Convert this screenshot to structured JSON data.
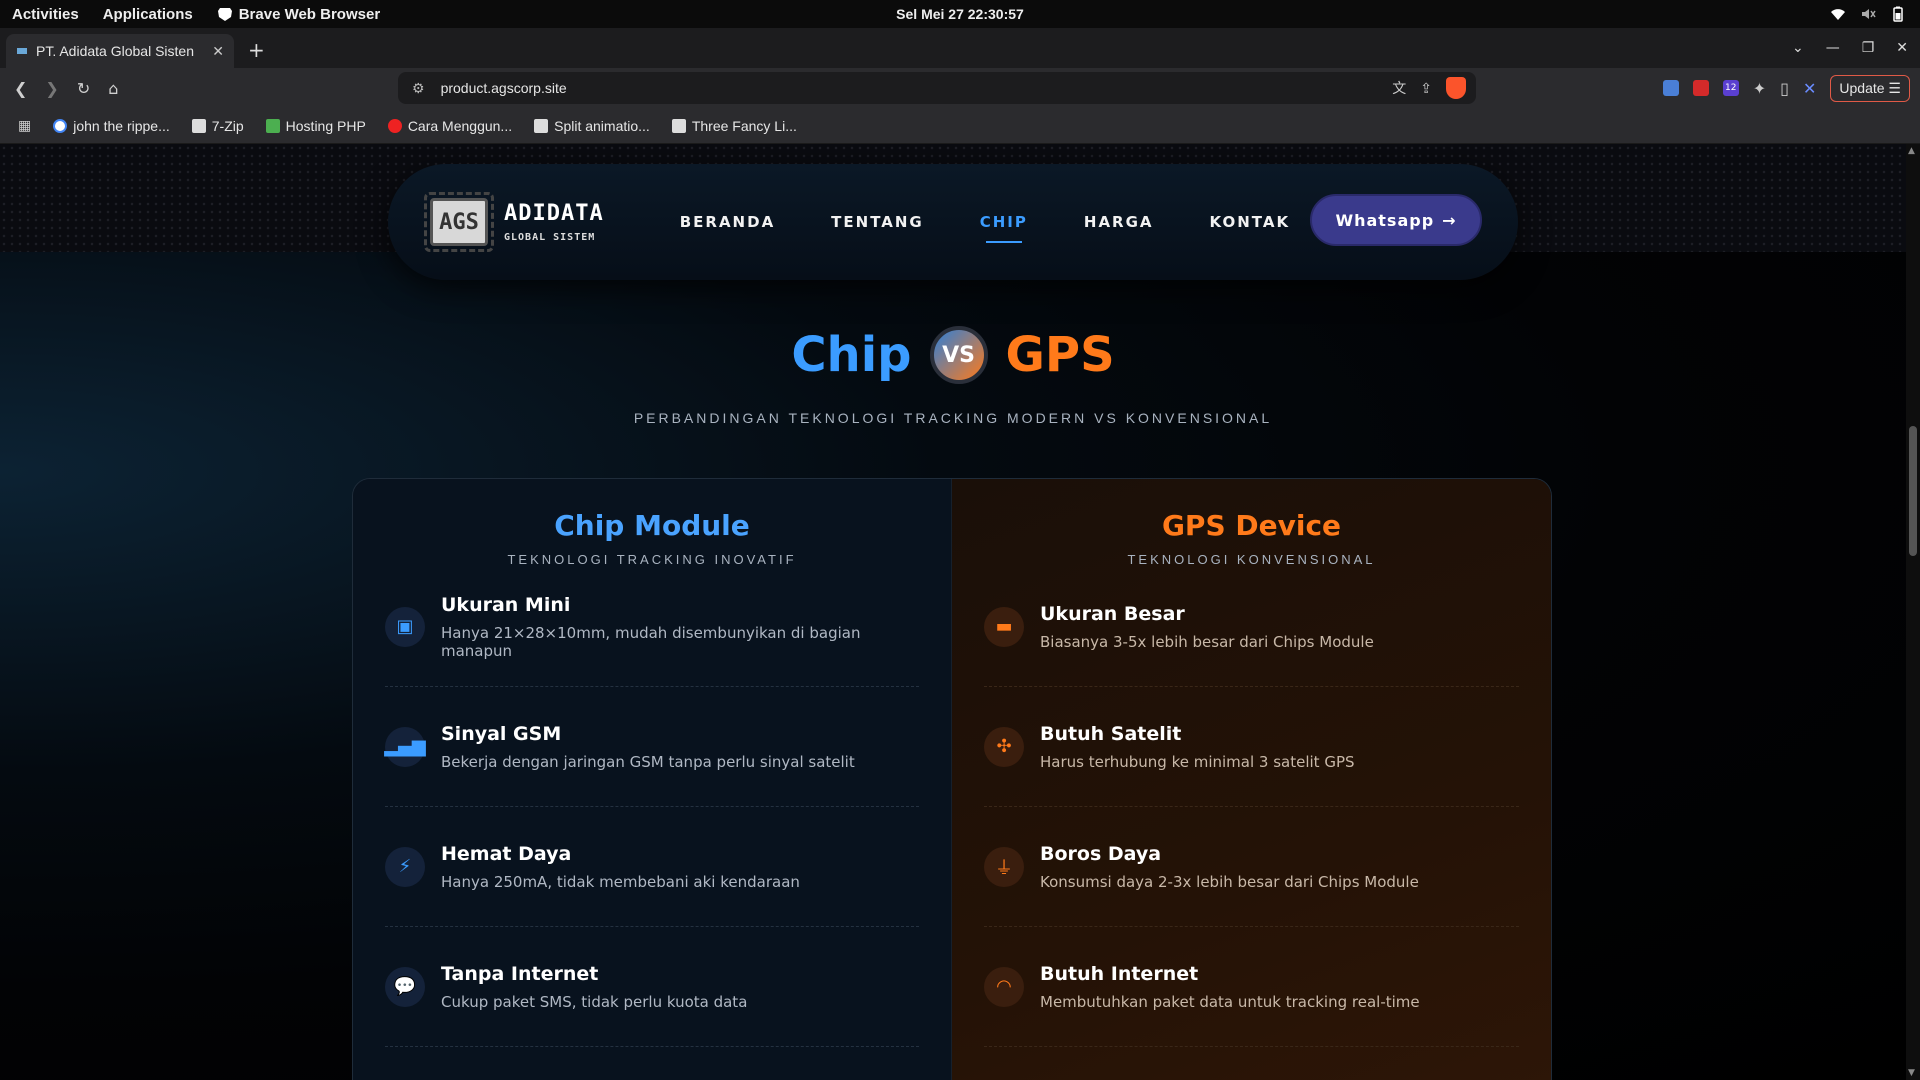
{
  "topbar": {
    "activities": "Activities",
    "applications": "Applications",
    "app_name": "Brave Web Browser",
    "clock": "Sel Mei 27  22:30:57"
  },
  "browser": {
    "tab_title": "PT. Adidata Global Sisten",
    "url": "product.agscorp.site",
    "update_label": "Update",
    "ext_badge": "12",
    "bookmarks": [
      "john the rippe...",
      "7-Zip",
      "Hosting PHP",
      "Cara Menggun...",
      "Split animatio...",
      "Three Fancy Li..."
    ]
  },
  "site": {
    "logo_mark": "AGS",
    "logo_line1": "ADIDATA",
    "logo_line2": "GLOBAL SISTEM",
    "menu": [
      "BERANDA",
      "TENTANG",
      "CHIP",
      "HARGA",
      "KONTAK"
    ],
    "active_menu": "CHIP",
    "whatsapp": "Whatsapp",
    "hero_left": "Chip",
    "hero_vs": "VS",
    "hero_right": "GPS",
    "hero_sub": "PERBANDINGAN TEKNOLOGI TRACKING MODERN VS KONVENSIONAL",
    "left": {
      "title": "Chip Module",
      "subtitle": "TEKNOLOGI TRACKING INOVATIF",
      "features": [
        {
          "title": "Ukuran Mini",
          "desc": "Hanya 21×28×10mm, mudah disembunyikan di bagian manapun",
          "icon": "microchip-icon"
        },
        {
          "title": "Sinyal GSM",
          "desc": "Bekerja dengan jaringan GSM tanpa perlu sinyal satelit",
          "icon": "signal-icon"
        },
        {
          "title": "Hemat Daya",
          "desc": "Hanya 250mA, tidak membebani aki kendaraan",
          "icon": "bolt-icon"
        },
        {
          "title": "Tanpa Internet",
          "desc": "Cukup paket SMS, tidak perlu kuota data",
          "icon": "sms-icon"
        }
      ]
    },
    "right": {
      "title": "GPS Device",
      "subtitle": "TEKNOLOGI KONVENSIONAL",
      "features": [
        {
          "title": "Ukuran Besar",
          "desc": "Biasanya 3-5x lebih besar dari Chips Module",
          "icon": "box-icon"
        },
        {
          "title": "Butuh Satelit",
          "desc": "Harus terhubung ke minimal 3 satelit GPS",
          "icon": "satellite-icon"
        },
        {
          "title": "Boros Daya",
          "desc": "Konsumsi daya 2-3x lebih besar dari Chips Module",
          "icon": "plug-icon"
        },
        {
          "title": "Butuh Internet",
          "desc": "Membutuhkan paket data untuk tracking real-time",
          "icon": "wifi-icon"
        }
      ]
    }
  },
  "colors": {
    "chip_blue": "#3b9cff",
    "gps_orange": "#ff7a1a",
    "whatsapp_btn": "#3a3a8c"
  }
}
